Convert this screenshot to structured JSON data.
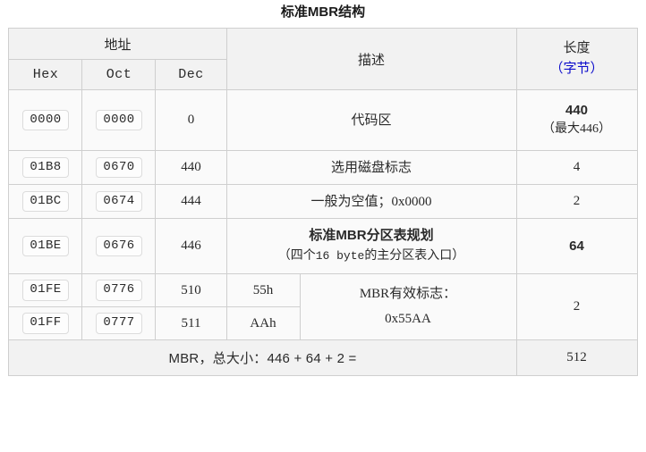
{
  "title": "标准MBR结构",
  "colors": {
    "accent_blue": "#0d0dcc",
    "header_bg": "#f2f2f2",
    "row_bg": "#fafafa",
    "border": "#cfcfcf",
    "outer_border": "#b9b9b9",
    "text": "#2a2a2a"
  },
  "table": {
    "header": {
      "address_group": "地址",
      "hex": "Hex",
      "oct": "Oct",
      "dec": "Dec",
      "description": "描述",
      "length_title": "长度",
      "length_unit": "（字节）"
    },
    "rows": [
      {
        "hex": "0000",
        "oct": "0000",
        "dec": "0",
        "desc": "代码区",
        "length_main": "440",
        "length_note": "（最大446）"
      },
      {
        "hex": "01B8",
        "oct": "0670",
        "dec": "440",
        "desc": "选用磁盘标志",
        "length_main": "4"
      },
      {
        "hex": "01BC",
        "oct": "0674",
        "dec": "444",
        "desc": "一般为空值；0x0000",
        "length_main": "2"
      },
      {
        "hex": "01BE",
        "oct": "0676",
        "dec": "446",
        "desc_bold": "标准MBR分区表规划",
        "desc_sub_pre": "（四个",
        "desc_sub_mono": "16 byte",
        "desc_sub_post": "的主分区表入口）",
        "length_main": "64"
      },
      {
        "hex": "01FE",
        "oct": "0776",
        "dec": "510",
        "sig": "55h",
        "sig_desc_line1": "MBR有效标志：",
        "sig_desc_line2": "0x55AA",
        "length_main": "2"
      },
      {
        "hex": "01FF",
        "oct": "0777",
        "dec": "511",
        "sig": "AAh"
      }
    ],
    "footer": {
      "label": "MBR，总大小：446 + 64 + 2 =",
      "value": "512"
    }
  }
}
